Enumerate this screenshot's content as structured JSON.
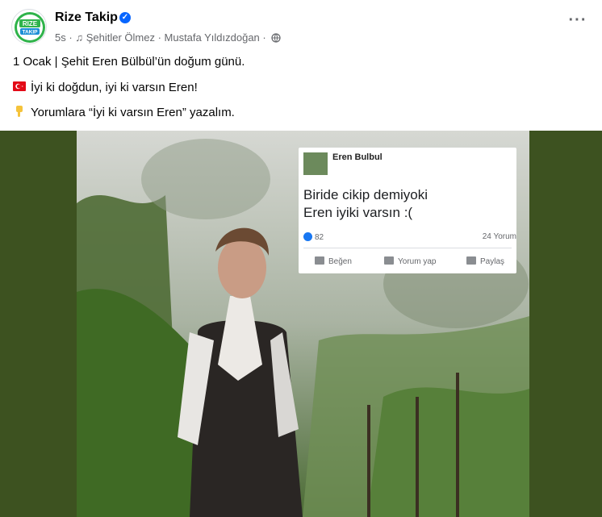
{
  "post": {
    "page_name": "Rize Takip",
    "avatar_text_top": "RIZE",
    "avatar_text_bottom": "TAKIP",
    "time": "5s",
    "audio": "Şehitler Ölmez · Mustafa Yıldızdoğan",
    "separator": "·",
    "more": "···",
    "lines": [
      "1 Ocak | Şehit Eren Bülbül’ün doğum günü.",
      "İyi ki doğdun, iyi ki varsın Eren!",
      "Yorumlara “İyi ki varsın Eren” yazalım."
    ]
  },
  "image_card": {
    "name": "Eren Bulbul",
    "text_line1": "Biride cikip demiyoki",
    "text_line2": "Eren iyiki varsın :(",
    "likes": "82",
    "comments": "24 Yorum",
    "actions": [
      "Beğen",
      "Yorum yap",
      "Paylaş"
    ]
  },
  "colors": {
    "brand": "#0866ff",
    "avatar_green": "#2fb34a",
    "media_bg": "#3d5220"
  }
}
